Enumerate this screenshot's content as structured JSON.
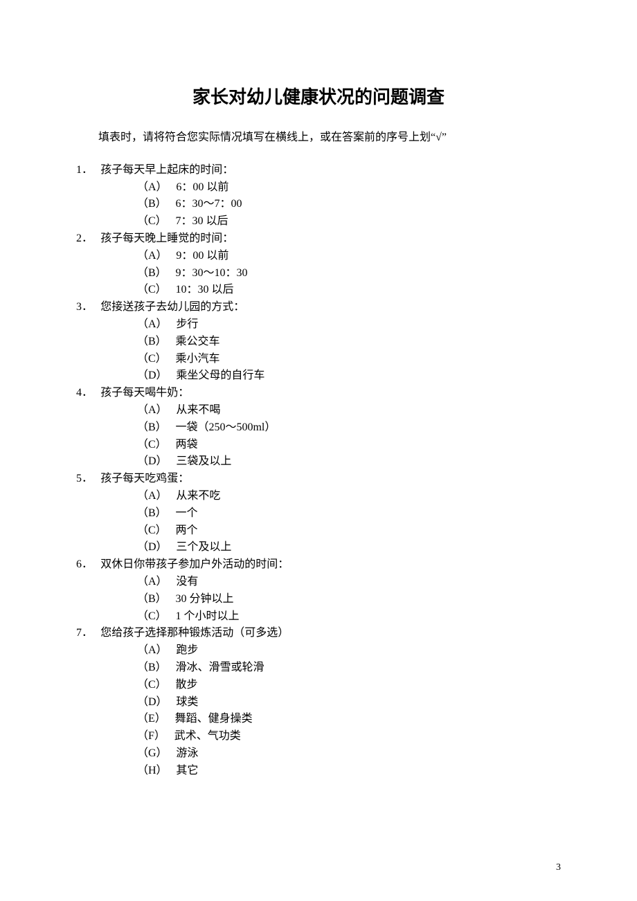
{
  "title": "家长对幼儿健康状况的问题调查",
  "instruction": "填表时，请将符合您实际情况填写在横线上，或在答案前的序号上划“√”",
  "questions": [
    {
      "num": "1．",
      "text": "孩子每天早上起床的时间：",
      "options": [
        {
          "label": "（A）",
          "text": "6：00 以前"
        },
        {
          "label": "（B）",
          "text": "6：30～7：00"
        },
        {
          "label": "（C）",
          "text": "7：30 以后"
        }
      ]
    },
    {
      "num": "2．",
      "text": "孩子每天晚上睡觉的时间：",
      "options": [
        {
          "label": "（A）",
          "text": "9：00 以前"
        },
        {
          "label": "（B）",
          "text": "9：30～10：30"
        },
        {
          "label": "（C）",
          "text": "10：30 以后"
        }
      ]
    },
    {
      "num": "3．",
      "text": "您接送孩子去幼儿园的方式：",
      "options": [
        {
          "label": "（A）",
          "text": "步行"
        },
        {
          "label": "（B）",
          "text": "乘公交车"
        },
        {
          "label": "（C）",
          "text": "乘小汽车"
        },
        {
          "label": "（D）",
          "text": "乘坐父母的自行车"
        }
      ]
    },
    {
      "num": "4．",
      "text": "孩子每天喝牛奶：",
      "options": [
        {
          "label": "（A）",
          "text": "从来不喝"
        },
        {
          "label": "（B）",
          "text": "一袋（250～500ml）"
        },
        {
          "label": "（C）",
          "text": "两袋"
        },
        {
          "label": "（D）",
          "text": "三袋及以上"
        }
      ]
    },
    {
      "num": "5．",
      "text": "孩子每天吃鸡蛋：",
      "options": [
        {
          "label": "（A）",
          "text": "从来不吃"
        },
        {
          "label": "（B）",
          "text": "一个"
        },
        {
          "label": "（C）",
          "text": "两个"
        },
        {
          "label": "（D）",
          "text": "三个及以上"
        }
      ]
    },
    {
      "num": "6．",
      "text": "双休日你带孩子参加户外活动的时间：",
      "options": [
        {
          "label": "（A）",
          "text": "没有"
        },
        {
          "label": "（B）",
          "text": "30 分钟以上"
        },
        {
          "label": "（C）",
          "text": "1 个小时以上"
        }
      ]
    },
    {
      "num": "7．",
      "text": "您给孩子选择那种锻炼活动（可多选）",
      "options": [
        {
          "label": "（A）",
          "text": "跑步"
        },
        {
          "label": "（B）",
          "text": "滑冰、滑雪或轮滑"
        },
        {
          "label": "（C）",
          "text": "散步"
        },
        {
          "label": "（D）",
          "text": "球类"
        },
        {
          "label": "（E）",
          "text": "舞蹈、健身操类"
        },
        {
          "label": "（F）",
          "text": "武术、气功类"
        },
        {
          "label": "（G）",
          "text": "游泳"
        },
        {
          "label": "（H）",
          "text": "其它"
        }
      ]
    }
  ],
  "pageNumber": "3"
}
